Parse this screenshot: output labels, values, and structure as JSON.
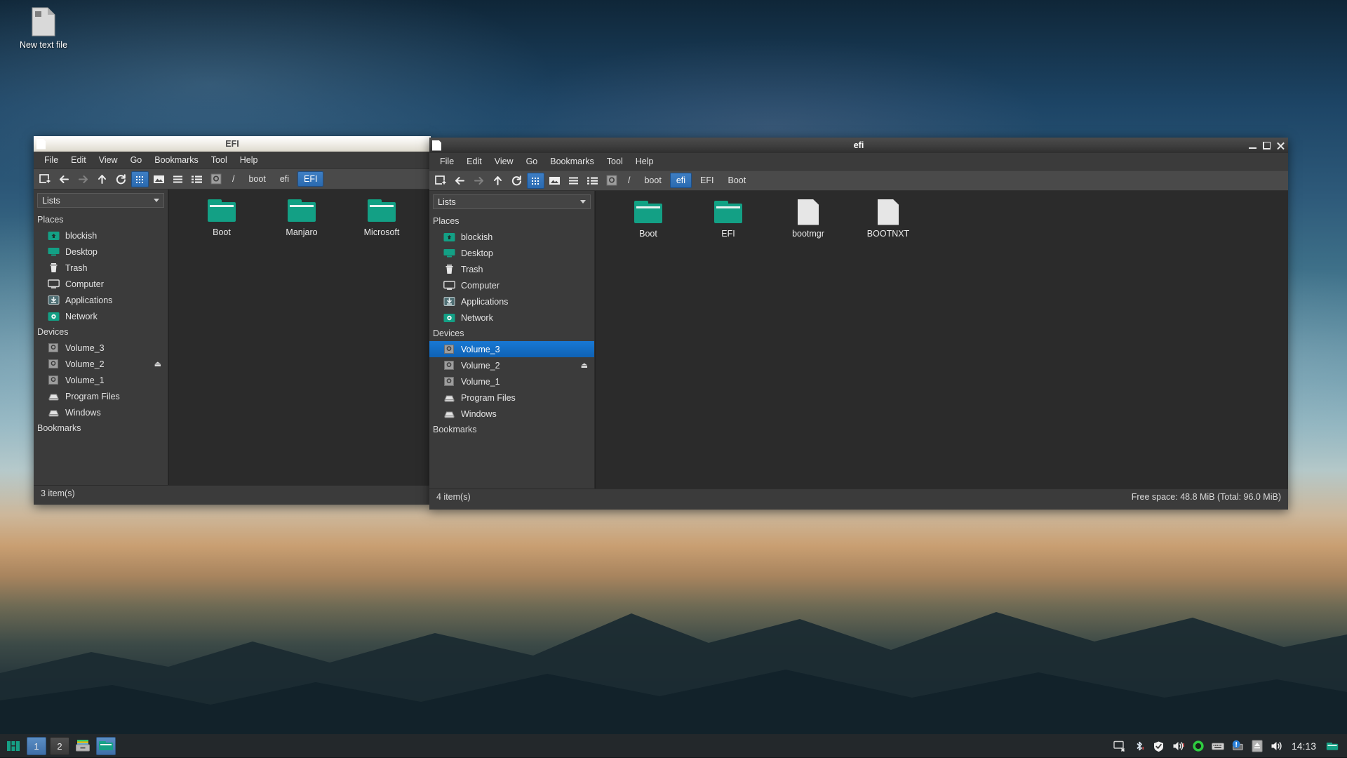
{
  "desktop": {
    "icons": [
      {
        "name": "New text file",
        "icon": "text-file-icon"
      }
    ]
  },
  "windows": [
    {
      "id": "left",
      "title": "EFI",
      "active": false,
      "window_icon": "file-manager-icon",
      "menus": [
        "File",
        "Edit",
        "View",
        "Go",
        "Bookmarks",
        "Tool",
        "Help"
      ],
      "toolbar": [
        {
          "name": "new-tab-button",
          "icon": "new-window-icon"
        },
        {
          "name": "back-button",
          "icon": "arrow-left-icon"
        },
        {
          "name": "forward-button",
          "icon": "arrow-right-icon"
        },
        {
          "name": "up-button",
          "icon": "arrow-up-icon"
        },
        {
          "name": "reload-button",
          "icon": "reload-icon"
        },
        {
          "name": "icon-view-button",
          "icon": "grid-view-icon",
          "selected": true
        },
        {
          "name": "thumbnail-view-button",
          "icon": "image-view-icon"
        },
        {
          "name": "compact-view-button",
          "icon": "list-lines-icon"
        },
        {
          "name": "detail-view-button",
          "icon": "detail-list-icon"
        }
      ],
      "path_icon": "volume-icon",
      "breadcrumbs": [
        {
          "label": "/",
          "selected": false
        },
        {
          "label": "boot",
          "selected": false
        },
        {
          "label": "efi",
          "selected": false
        },
        {
          "label": "EFI",
          "selected": true
        }
      ],
      "sidebar": {
        "combo_label": "Lists",
        "groups": [
          {
            "title": "Places",
            "items": [
              {
                "label": "blockish",
                "icon": "home-folder-icon"
              },
              {
                "label": "Desktop",
                "icon": "desktop-icon"
              },
              {
                "label": "Trash",
                "icon": "trash-icon"
              },
              {
                "label": "Computer",
                "icon": "computer-icon"
              },
              {
                "label": "Applications",
                "icon": "applications-icon"
              },
              {
                "label": "Network",
                "icon": "network-icon"
              }
            ]
          },
          {
            "title": "Devices",
            "items": [
              {
                "label": "Volume_3",
                "icon": "volume-icon"
              },
              {
                "label": "Volume_2",
                "icon": "volume-icon",
                "eject": true
              },
              {
                "label": "Volume_1",
                "icon": "volume-icon"
              },
              {
                "label": "Program Files",
                "icon": "drive-icon"
              },
              {
                "label": "Windows",
                "icon": "drive-icon"
              }
            ]
          },
          {
            "title": "Bookmarks",
            "items": []
          }
        ]
      },
      "files": [
        {
          "label": "Boot",
          "type": "folder"
        },
        {
          "label": "Manjaro",
          "type": "folder"
        },
        {
          "label": "Microsoft",
          "type": "folder"
        }
      ],
      "status_left": "3 item(s)",
      "status_right": ""
    },
    {
      "id": "right",
      "title": "efi",
      "active": true,
      "window_icon": "file-manager-icon",
      "menus": [
        "File",
        "Edit",
        "View",
        "Go",
        "Bookmarks",
        "Tool",
        "Help"
      ],
      "toolbar": [
        {
          "name": "new-tab-button",
          "icon": "new-window-icon"
        },
        {
          "name": "back-button",
          "icon": "arrow-left-icon"
        },
        {
          "name": "forward-button",
          "icon": "arrow-right-icon"
        },
        {
          "name": "up-button",
          "icon": "arrow-up-icon"
        },
        {
          "name": "reload-button",
          "icon": "reload-icon"
        },
        {
          "name": "icon-view-button",
          "icon": "grid-view-icon",
          "selected": true
        },
        {
          "name": "thumbnail-view-button",
          "icon": "image-view-icon"
        },
        {
          "name": "compact-view-button",
          "icon": "list-lines-icon"
        },
        {
          "name": "detail-view-button",
          "icon": "detail-list-icon"
        }
      ],
      "path_icon": "volume-icon",
      "breadcrumbs": [
        {
          "label": "/",
          "selected": false
        },
        {
          "label": "boot",
          "selected": false
        },
        {
          "label": "efi",
          "selected": true
        },
        {
          "label": "EFI",
          "selected": false
        },
        {
          "label": "Boot",
          "selected": false
        }
      ],
      "sidebar": {
        "combo_label": "Lists",
        "groups": [
          {
            "title": "Places",
            "items": [
              {
                "label": "blockish",
                "icon": "home-folder-icon"
              },
              {
                "label": "Desktop",
                "icon": "desktop-icon"
              },
              {
                "label": "Trash",
                "icon": "trash-icon"
              },
              {
                "label": "Computer",
                "icon": "computer-icon"
              },
              {
                "label": "Applications",
                "icon": "applications-icon"
              },
              {
                "label": "Network",
                "icon": "network-icon"
              }
            ]
          },
          {
            "title": "Devices",
            "items": [
              {
                "label": "Volume_3",
                "icon": "volume-icon",
                "selected": true
              },
              {
                "label": "Volume_2",
                "icon": "volume-icon",
                "eject": true
              },
              {
                "label": "Volume_1",
                "icon": "volume-icon"
              },
              {
                "label": "Program Files",
                "icon": "drive-icon"
              },
              {
                "label": "Windows",
                "icon": "drive-icon"
              }
            ]
          },
          {
            "title": "Bookmarks",
            "items": []
          }
        ]
      },
      "files": [
        {
          "label": "Boot",
          "type": "folder"
        },
        {
          "label": "EFI",
          "type": "folder"
        },
        {
          "label": "bootmgr",
          "type": "file"
        },
        {
          "label": "BOOTNXT",
          "type": "file"
        }
      ],
      "status_left": "4 item(s)",
      "status_right": "Free space: 48.8 MiB (Total: 96.0 MiB)",
      "window_buttons": [
        "minimize",
        "maximize",
        "close"
      ]
    }
  ],
  "taskbar": {
    "launcher": {
      "name": "manjaro-menu-icon"
    },
    "workspaces": [
      {
        "label": "1",
        "active": true
      },
      {
        "label": "2",
        "active": false
      }
    ],
    "tasks": [
      {
        "name": "task-archive",
        "icon": "archive-icon"
      },
      {
        "name": "task-file-manager",
        "icon": "folder-icon",
        "active": true
      }
    ],
    "tray": [
      {
        "name": "display-off-icon"
      },
      {
        "name": "bluetooth-icon"
      },
      {
        "name": "shield-icon"
      },
      {
        "name": "volume-muted-icon"
      },
      {
        "name": "recording-icon"
      },
      {
        "name": "keyboard-icon"
      },
      {
        "name": "update-notification-icon"
      },
      {
        "name": "eject-icon"
      },
      {
        "name": "speaker-icon"
      }
    ],
    "clock": "14:13",
    "end_icon": "folder-green-icon"
  },
  "colors": {
    "accent_blue": "#1878d4",
    "folder_green": "#13a085",
    "window_bg": "#3b3b3b",
    "content_bg": "#2b2b2b"
  }
}
